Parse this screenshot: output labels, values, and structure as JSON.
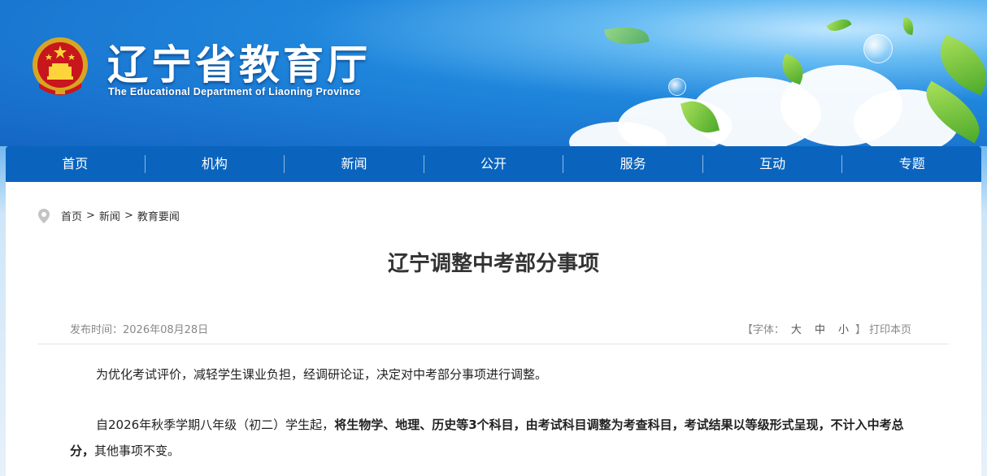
{
  "site": {
    "title": "辽宁省教育厅",
    "subtitle": "The Educational Department of Liaoning Province"
  },
  "nav": [
    {
      "label": "首页"
    },
    {
      "label": "机构"
    },
    {
      "label": "新闻"
    },
    {
      "label": "公开"
    },
    {
      "label": "服务"
    },
    {
      "label": "互动"
    },
    {
      "label": "专题"
    }
  ],
  "breadcrumb": {
    "items": [
      "首页",
      "新闻",
      "教育要闻"
    ],
    "separator": ">"
  },
  "article": {
    "title": "辽宁调整中考部分事项",
    "publish_label": "发布时间：",
    "publish_date": "2026年08月28日",
    "font_tools": {
      "open": "【字体：",
      "large": "大",
      "medium": "中",
      "small": "小",
      "close": "】",
      "print": "打印本页"
    },
    "paragraph1": "为优化考试评价，减轻学生课业负担，经调研论证，决定对中考部分事项进行调整。",
    "paragraph2_prefix": "自2026年秋季学期八年级（初二）学生起，",
    "paragraph2_bold": "将生物学、地理、历史等3个科目，由考试科目调整为考查科目，考试结果以等级形式呈现，不计入中考总分，",
    "paragraph2_suffix": "其他事项不变。"
  },
  "colors": {
    "nav_bg": "#0a64be",
    "title_text": "#333333"
  }
}
